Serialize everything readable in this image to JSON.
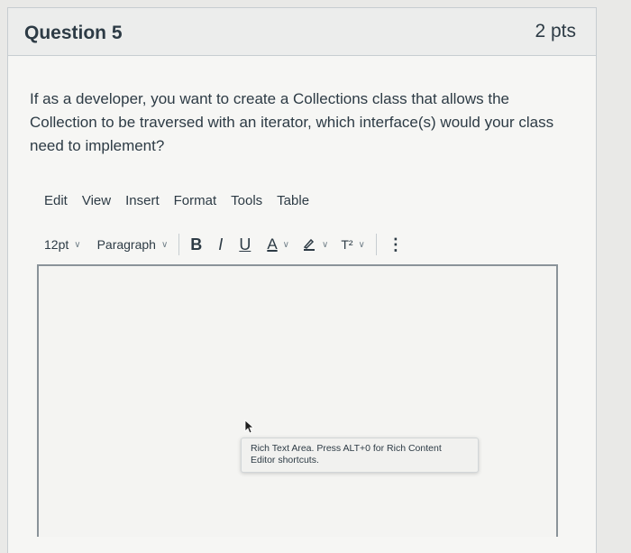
{
  "question": {
    "title": "Question 5",
    "points": "2 pts",
    "text": "If as a developer, you want to create a Collections class that allows the Collection to be traversed with an iterator, which interface(s) would your class need to implement?"
  },
  "editor": {
    "menu": [
      "Edit",
      "View",
      "Insert",
      "Format",
      "Tools",
      "Table"
    ],
    "font_size": "12pt",
    "block_format": "Paragraph",
    "bold_label": "B",
    "italic_label": "I",
    "underline_label": "U",
    "text_color_label": "A",
    "superscript_label": "T²",
    "more_label": "⋮",
    "tooltip": "Rich Text Area. Press ALT+0 for Rich Content Editor shortcuts."
  },
  "colors": {
    "text": "#2d3b45",
    "border": "#c7cdd1",
    "editor_border": "#8a9399"
  }
}
